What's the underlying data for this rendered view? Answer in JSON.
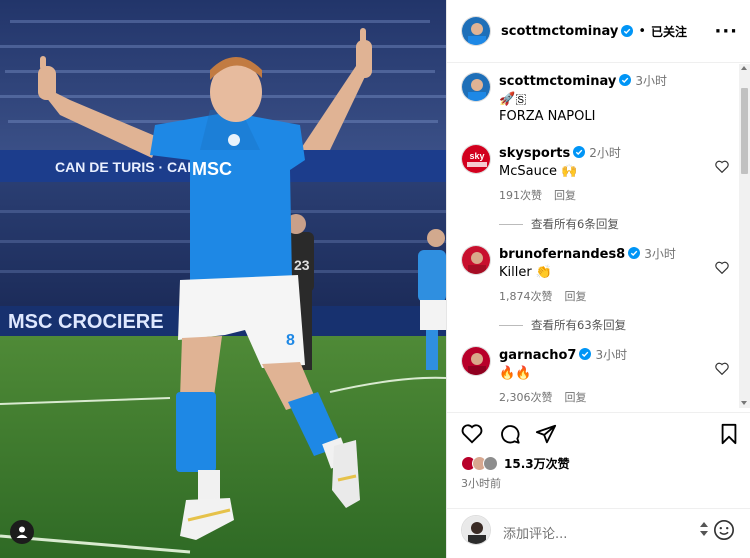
{
  "post": {
    "author": "scottmctominay",
    "follow_status": "已关注",
    "more_icon": "more-icon",
    "caption_time": "3小时",
    "caption_line1": "🚀🇸",
    "caption_line2": "FORZA NAPOLI"
  },
  "photo": {
    "banner1": "MSC CROCIERE",
    "banner2": "CAN DE TURIS · CAIV",
    "shirt_sponsor": "MSC",
    "shirt_number": "8",
    "opponent_number": "23"
  },
  "comments": [
    {
      "user": "skysports",
      "time": "2小时",
      "text": "McSauce 🙌",
      "likes": "191次赞",
      "reply": "回复"
    },
    {
      "user": "brunofernandes8",
      "time": "3小时",
      "text": "Killer 👏",
      "likes": "1,874次赞",
      "reply": "回复"
    },
    {
      "user": "garnacho7",
      "time": "3小时",
      "text": "🔥🔥",
      "likes": "2,306次赞",
      "reply": "回复"
    }
  ],
  "view_replies": [
    "查看所有6条回复",
    "查看所有63条回复"
  ],
  "actions": {
    "likes_count": "15.3万次赞",
    "posted_ago": "3小时前"
  },
  "add_comment": {
    "placeholder": "添加评论..."
  },
  "colors": {
    "verified": "#0095f6",
    "napoli_blue": "#1e88e5",
    "pitch": "#3f7a2f"
  }
}
